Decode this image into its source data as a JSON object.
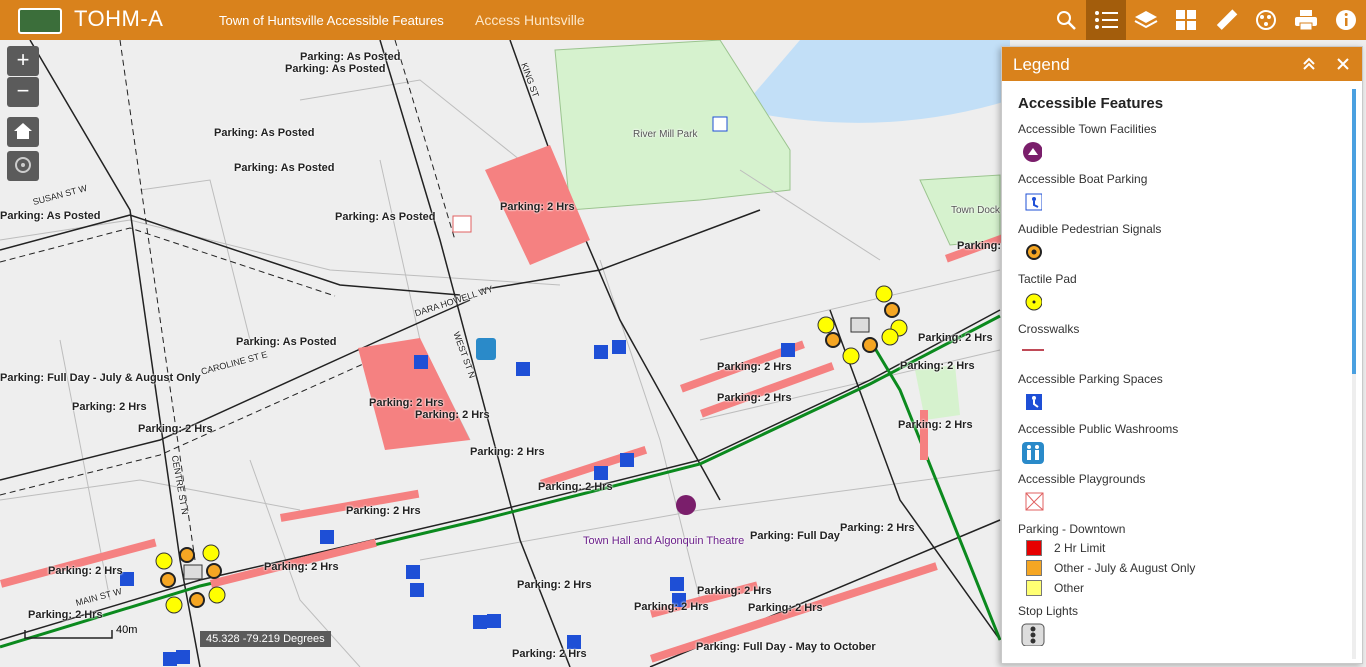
{
  "header": {
    "app_title": "TOHM-A",
    "subtitle": "Town of Huntsville Accessible Features",
    "link": "Access Huntsville",
    "tools": [
      "search-icon",
      "legend-icon",
      "layers-icon",
      "basemap-icon",
      "measure-icon",
      "draw-icon",
      "print-icon",
      "info-icon"
    ]
  },
  "map": {
    "zoom_in": "+",
    "zoom_out": "−",
    "coordinates": "45.328 -79.219 Degrees",
    "scale": "40m",
    "labels": {
      "parking_as_posted": "Parking: As Posted",
      "parking_2hrs": "Parking: 2 Hrs",
      "parking_full_day": "Parking: Full Day",
      "parking_full_day_july": "Parking: Full Day - July & August Only",
      "parking_may_oct": "Parking: Full Day - May to October",
      "town_hall": "Town Hall and Algonquin Theatre",
      "river_mill_park": "River Mill Park",
      "town_dock": "Town Dock I",
      "susan_st": "SUSAN ST W",
      "caroline_st": "CAROLINE ST E",
      "dara_howell": "DARA HOWELL WY",
      "main_st": "MAIN ST W",
      "king_st": "KING ST",
      "west_st": "WEST ST N",
      "centre_st": "CENTRE ST N"
    }
  },
  "legend": {
    "title": "Legend",
    "section_title": "Accessible Features",
    "items": [
      {
        "label": "Accessible Town Facilities",
        "icon": "town-facility-icon"
      },
      {
        "label": "Accessible Boat Parking",
        "icon": "boat-parking-icon"
      },
      {
        "label": "Audible Pedestrian Signals",
        "icon": "audible-signal-icon"
      },
      {
        "label": "Tactile Pad",
        "icon": "tactile-pad-icon"
      },
      {
        "label": "Crosswalks",
        "icon": "crosswalk-icon"
      },
      {
        "label": "Accessible Parking Spaces",
        "icon": "parking-space-icon"
      },
      {
        "label": "Accessible Public Washrooms",
        "icon": "washroom-icon"
      },
      {
        "label": "Accessible Playgrounds",
        "icon": "playground-icon"
      }
    ],
    "parking": {
      "label": "Parking - Downtown",
      "classes": [
        {
          "label": "2 Hr Limit",
          "color": "#e60000"
        },
        {
          "label": "Other - July & August Only",
          "color": "#f5a623"
        },
        {
          "label": "Other",
          "color": "#ffff73"
        }
      ]
    },
    "stop_lights": "Stop Lights",
    "colors": {
      "accent": "#d9821c",
      "water": "#c2dff7",
      "park": "#d6f2ce",
      "parking_zone": "#f58181"
    }
  }
}
